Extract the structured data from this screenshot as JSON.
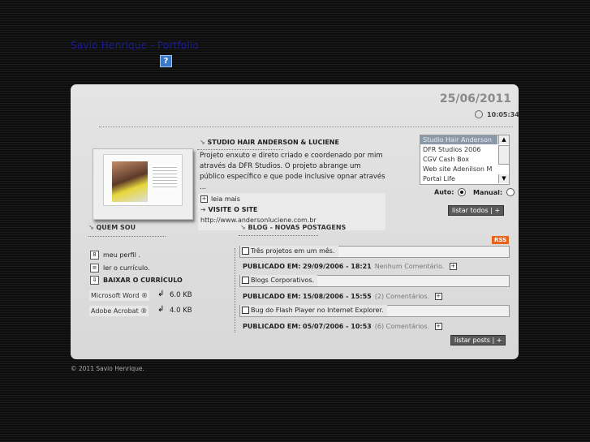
{
  "header": {
    "site_title": "Savio Henrique - Portfolio",
    "help": "?"
  },
  "panel": {
    "date": "25/06/2011",
    "time": "10:05:34",
    "project": {
      "title": "STUDIO HAIR ANDERSON & LUCIENE",
      "description": "Projeto enxuto e direto criado e coordenado por mim através da DFR Studios. O projeto abrange um público específico e que pode inclusive opnar através ...",
      "read_more": "leia mais",
      "visit_site": "VISITE O SITE",
      "url": "http://www.andersonluciene.com.br"
    },
    "ticker": {
      "items": [
        "Studio Hair Anderson",
        "DFR Studios 2006",
        "CGV Cash Box",
        "Web site Adenilson M",
        "Portal Life"
      ],
      "auto_label": "Auto:",
      "manual_label": "Manual:",
      "selected_mode": "Auto",
      "list_all": "listar todos | +"
    },
    "about": {
      "title": "QUEM SOU",
      "profile": "meu perfil .",
      "resume": "ler o currículo.",
      "download": "BAIXAR O CURRÍCULO",
      "files": [
        {
          "name": "Microsoft Word ®",
          "size": "6.0 KB"
        },
        {
          "name": "Adobe Acrobat ®",
          "size": "4.0 KB"
        }
      ]
    },
    "blog": {
      "title": "BLOG - NOVAS POSTAGENS",
      "rss": "RSS",
      "posts": [
        {
          "title": "Três projetos em um mês.",
          "published_label": "PUBLICADO EM:",
          "date": "29/09/2006 - 18:21",
          "comments": "Nenhum Comentário."
        },
        {
          "title": "Blogs Corporativos.",
          "published_label": "PUBLICADO EM:",
          "date": "15/08/2006 - 15:55",
          "comments": "(2) Comentários."
        },
        {
          "title": "Bug do Flash Player no Internet Explorer.",
          "published_label": "PUBLICADO EM:",
          "date": "05/07/2006 - 10:53",
          "comments": "(6) Comentários."
        }
      ],
      "list_posts": "listar posts | +"
    }
  },
  "footer": {
    "copyright": "© 2011 Savio Henrique."
  }
}
